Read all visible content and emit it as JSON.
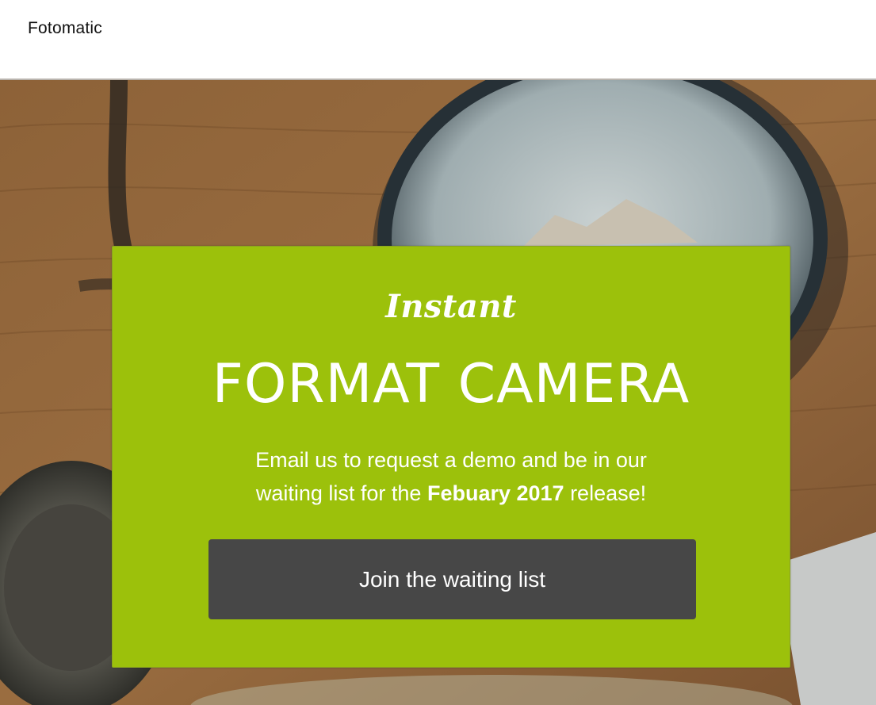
{
  "header": {
    "brand": "Fotomatic"
  },
  "hero": {
    "eyebrow": "Instant",
    "headline": "FORMAT CAMERA",
    "lead": {
      "line1": "Email us to request a demo and be in our",
      "line2_pre": "waiting list for the ",
      "line2_bold": "Febuary 2017",
      "line2_post": " release!"
    },
    "cta_label": "Join the waiting list"
  },
  "colors": {
    "card_background": "#9cc10b",
    "button_background": "#474747",
    "text_on_card": "#ffffff"
  }
}
